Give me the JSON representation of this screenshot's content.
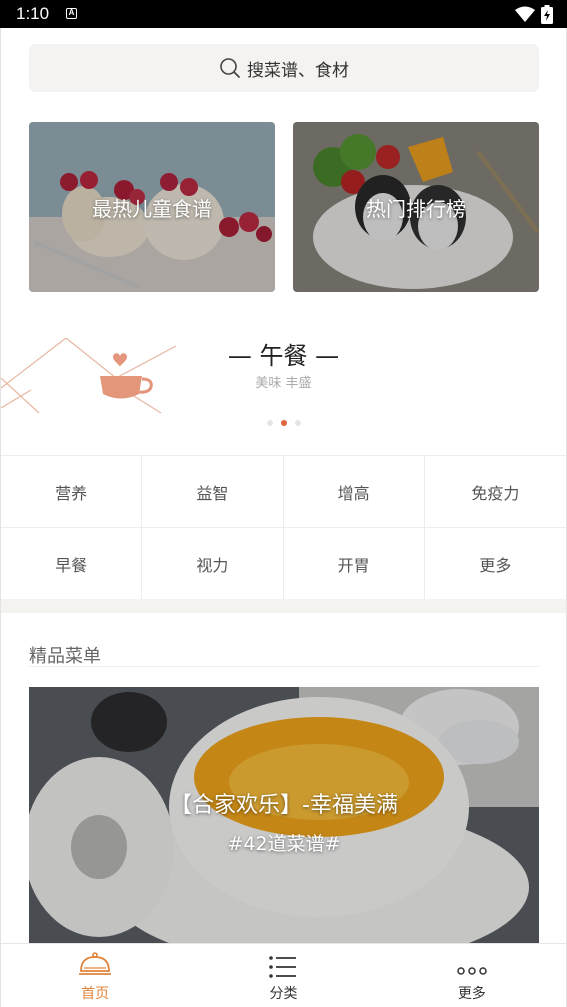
{
  "status_bar": {
    "time": "1:10",
    "notification_letter": "A"
  },
  "search": {
    "placeholder": "搜菜谱、食材"
  },
  "banners": [
    {
      "title": "最热儿童食谱"
    },
    {
      "title": "热门排行榜"
    }
  ],
  "meal": {
    "title": "— 午餐 —",
    "subtitle": "美味 丰盛",
    "page_index": 2,
    "page_count": 3
  },
  "categories": [
    "营养",
    "益智",
    "增高",
    "免疫力",
    "早餐",
    "视力",
    "开胃",
    "更多"
  ],
  "section": {
    "title": "精品菜单"
  },
  "feature": {
    "title": "【合家欢乐】-幸福美满",
    "subtitle": "#42道菜谱#"
  },
  "nav": [
    {
      "label": "首页",
      "icon": "cloche-icon",
      "active": true
    },
    {
      "label": "分类",
      "icon": "list-icon",
      "active": false
    },
    {
      "label": "更多",
      "icon": "more-dots-icon",
      "active": false
    }
  ],
  "colors": {
    "accent": "#e0843b",
    "dot_active": "#e0643b",
    "search_bg": "#f4f3f1"
  }
}
